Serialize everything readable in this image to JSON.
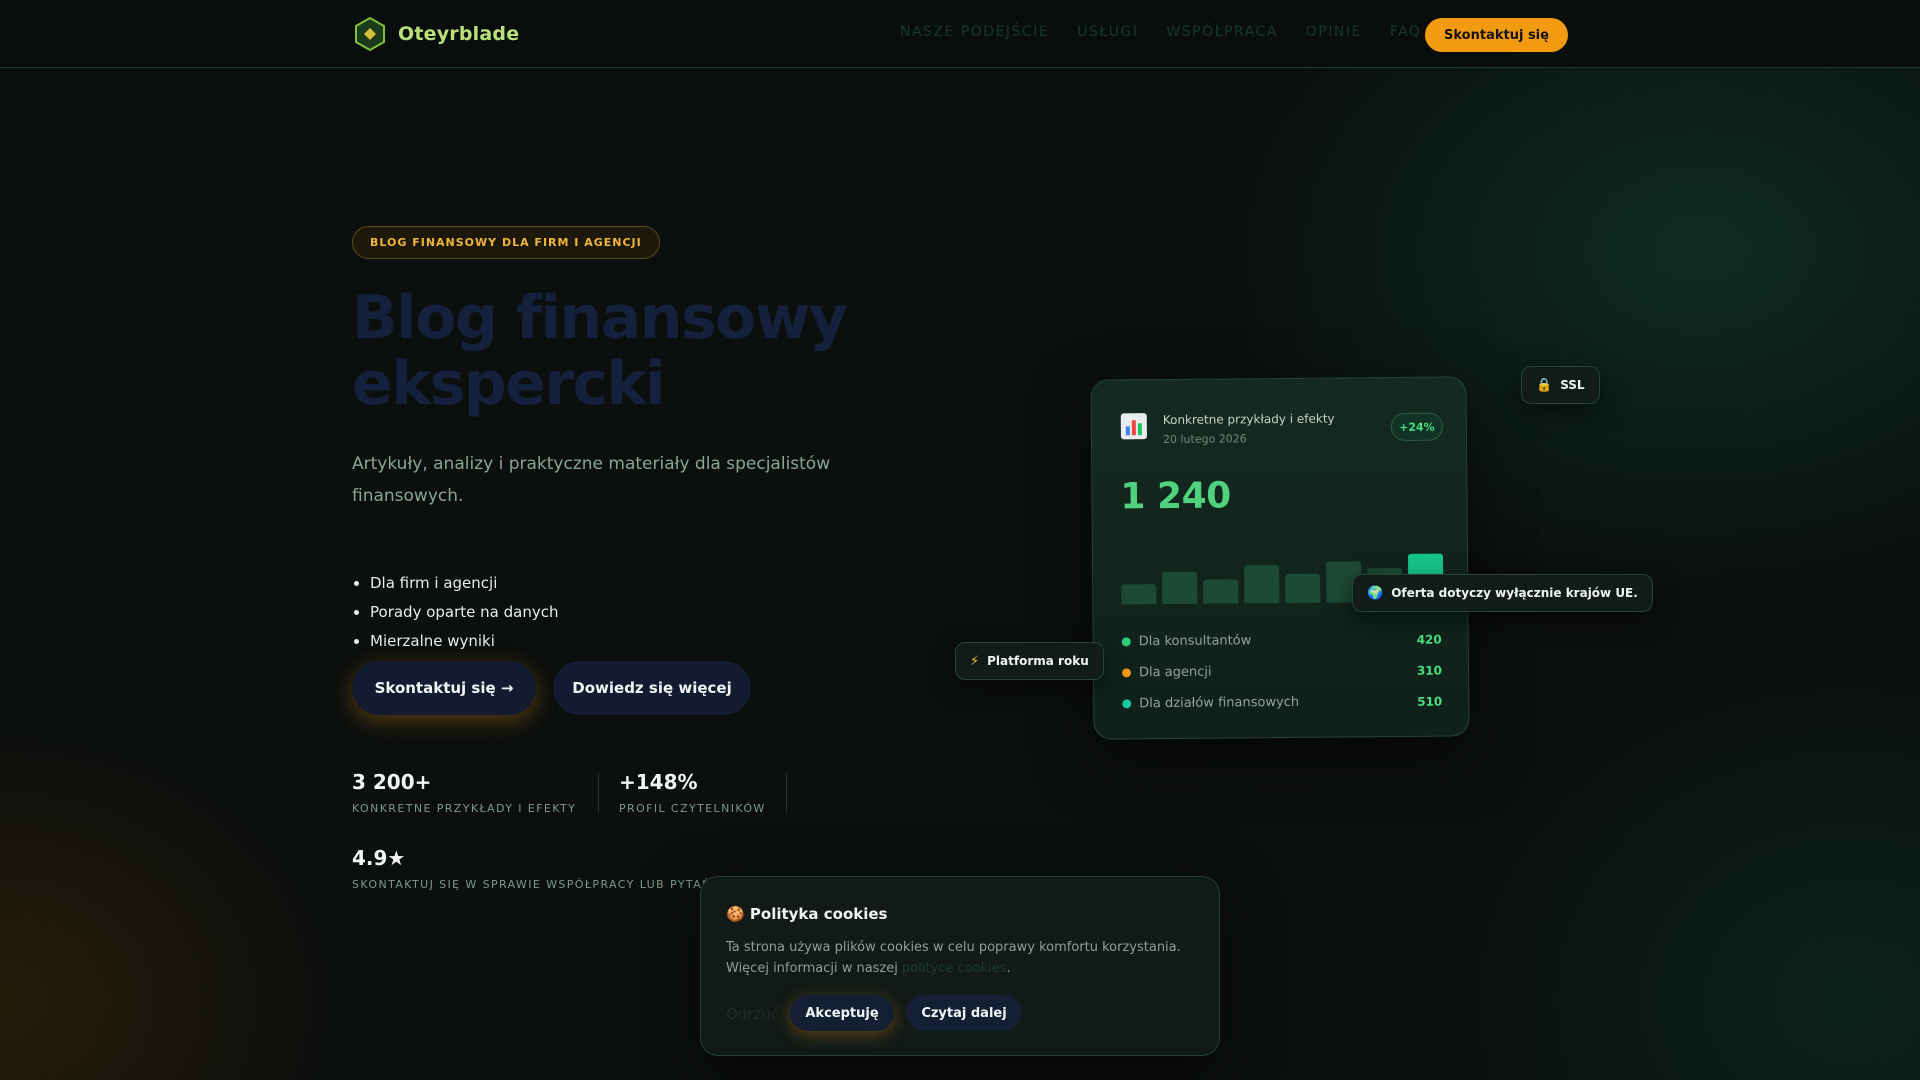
{
  "nav": {
    "brand": "Oteyrblade",
    "links": [
      "NASZE PODEJŚCIE",
      "USŁUGI",
      "WSPÓŁPRACA",
      "OPINIE",
      "FAQ"
    ],
    "cta": "Skontaktuj się"
  },
  "hero": {
    "badge": "BLOG FINANSOWY DLA FIRM I AGENCJI",
    "title": "Blog finansowy ekspercki",
    "subtitle": "Artykuły, analizy i praktyczne materiały dla specjalistów finansowych.",
    "bullets": [
      "Dla firm i agencji",
      "Porady oparte na danych",
      "Mierzalne wyniki"
    ],
    "primary_button": "Skontaktuj się →",
    "secondary_button": "Dowiedz się więcej"
  },
  "stats": [
    {
      "value": "3 200+",
      "label": "KONKRETNE PRZYKŁADY I EFEKTY"
    },
    {
      "value": "+148%",
      "label": "PROFIL CZYTELNIKÓW"
    },
    {
      "value": "4.9★",
      "label": "SKONTAKTUJ SIĘ W SPRAWIE WSPÓŁPRACY LUB PYTAŃ"
    }
  ],
  "card": {
    "title": "Konkretne przykłady i efekty",
    "date": "20 lutego 2026",
    "pill": "+24%",
    "big_value": "1 240",
    "bar_levels": [
      0.42,
      0.66,
      0.5,
      0.8,
      0.6,
      0.86,
      0.7,
      1.0
    ],
    "rows": [
      {
        "label": "Dla konsultantów",
        "value": "420",
        "color": "#2fcf7a"
      },
      {
        "label": "Dla agencji",
        "value": "310",
        "color": "#f29a12"
      },
      {
        "label": "Dla działów finansowych",
        "value": "510",
        "color": "#19c7a0"
      }
    ]
  },
  "chips": {
    "ssl": "SSL",
    "eu": "Oferta dotyczy wyłącznie krajów UE.",
    "platform": "Platforma roku"
  },
  "cookie": {
    "title": "🍪 Polityka cookies",
    "text_before": "Ta strona używa plików cookies w celu poprawy komfortu korzystania. Więcej informacji w naszej ",
    "link": "polityce cookies",
    "text_after": ".",
    "reject": "Odrzuć",
    "accept": "Akceptuję",
    "more": "Czytaj dalej"
  },
  "colors": {
    "accent": "#f29a12",
    "brand_green": "#b9e07a",
    "positive": "#4ade80"
  }
}
